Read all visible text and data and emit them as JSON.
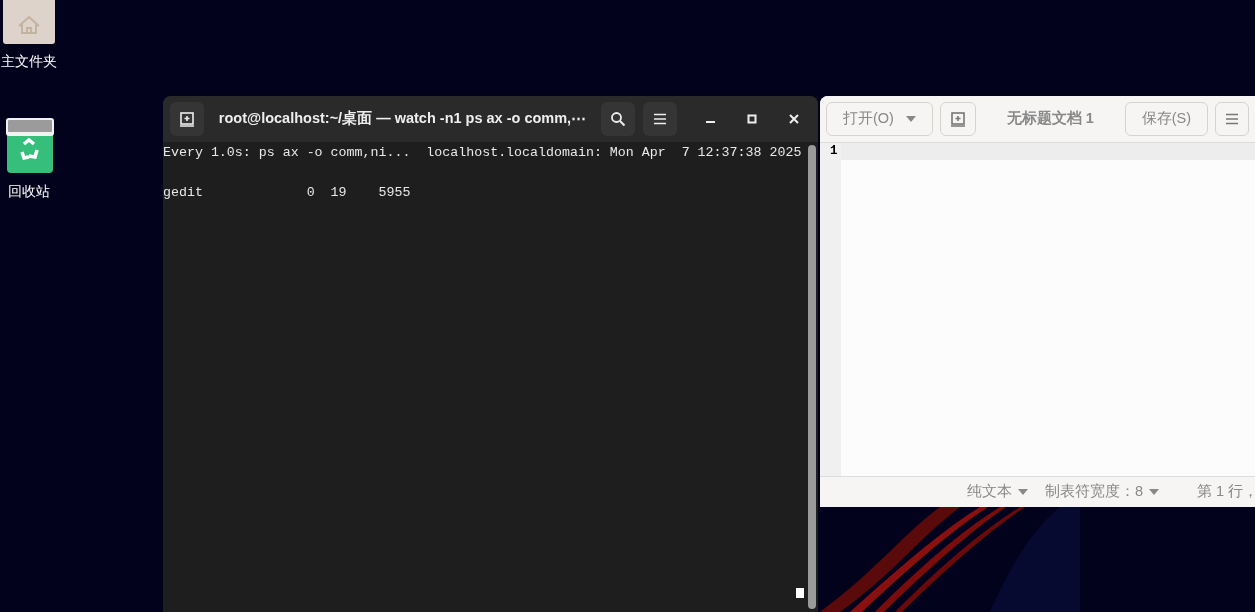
{
  "desktop_icons": [
    {
      "label": "主文件夹",
      "kind": "folder"
    },
    {
      "label": "回收站",
      "kind": "trash"
    }
  ],
  "terminal": {
    "title": "root@localhost:~/桌面 — watch -n1 ps ax -o comm,⋯",
    "header_line": "Every 1.0s: ps ax -o comm,ni...  localhost.localdomain: Mon Apr  7 12:37:38 2025",
    "rows": [
      "gedit             0  19    5955"
    ]
  },
  "editor": {
    "open_button": "打开(O)",
    "title": "无标题文档 1",
    "save_button": "保存(S)",
    "line_numbers": [
      "1"
    ],
    "status_bar": [
      {
        "label": "纯文本",
        "dropdown": true
      },
      {
        "label": "制表符宽度：8",
        "dropdown": true
      },
      {
        "label": "第 1 行，",
        "dropdown": false
      }
    ]
  }
}
